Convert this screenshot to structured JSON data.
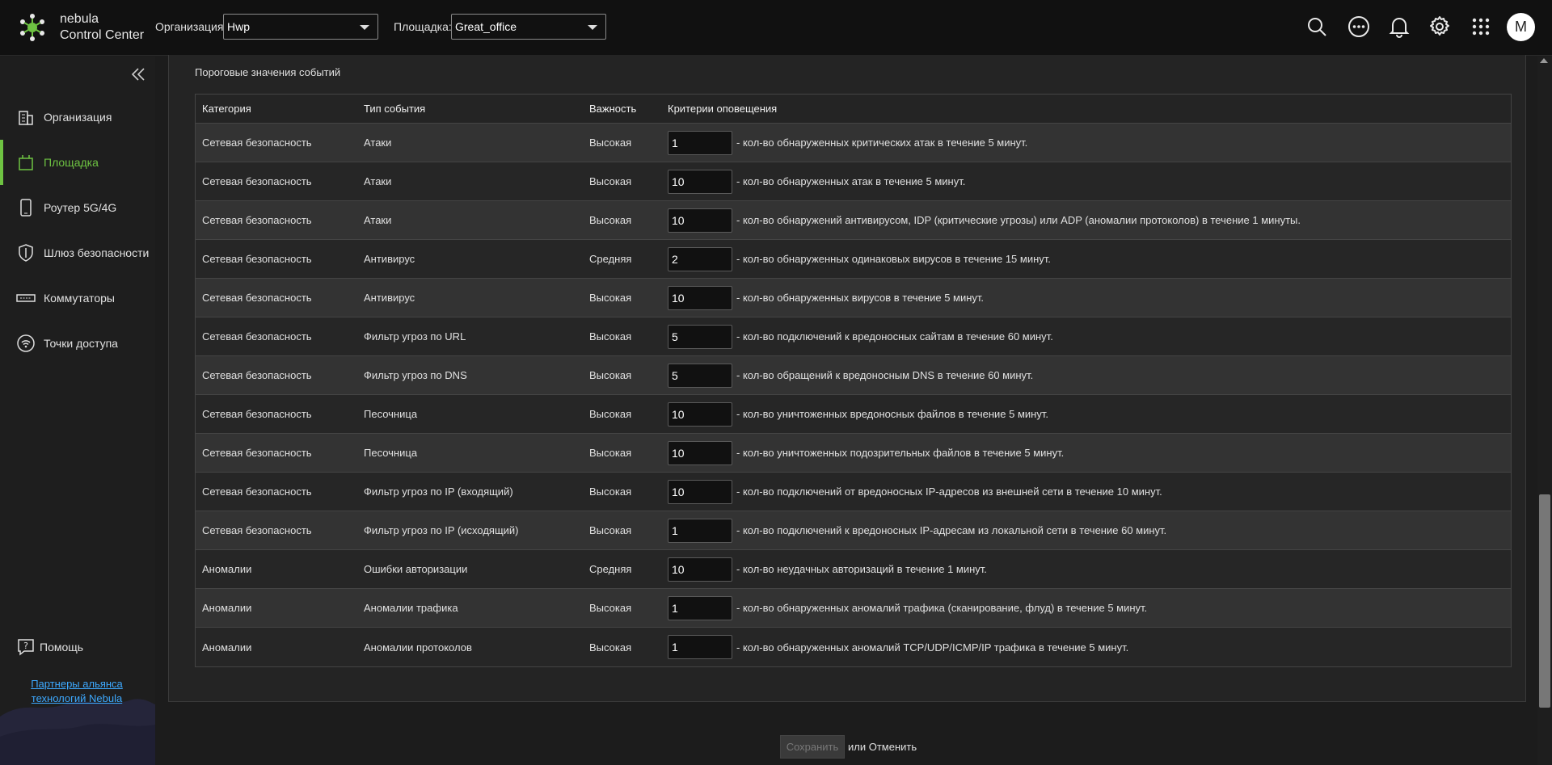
{
  "header": {
    "brand_line1": "nebula",
    "brand_line2": "Control Center",
    "org_label": "Организация:",
    "org_value": "Hwp",
    "site_label": "Площадка:",
    "site_value": "Great_office",
    "avatar_letter": "M",
    "icons": [
      "search-icon",
      "more-icon",
      "bell-icon",
      "gear-icon",
      "apps-grid-icon"
    ]
  },
  "sidebar": {
    "items": [
      {
        "label": "Организация",
        "icon": "building-icon"
      },
      {
        "label": "Площадка",
        "icon": "site-icon",
        "active": true
      },
      {
        "label": "Роутер 5G/4G",
        "icon": "mobile-router-icon"
      },
      {
        "label": "Шлюз безопасности",
        "icon": "shield-icon"
      },
      {
        "label": "Коммутаторы",
        "icon": "switch-icon"
      },
      {
        "label": "Точки доступа",
        "icon": "access-point-icon"
      }
    ],
    "help_label": "Помощь",
    "partners_line1": "Партнеры альянса",
    "partners_line2": "технологий Nebula"
  },
  "section": {
    "title": "Пороговые значения событий",
    "columns": [
      "Категория",
      "Тип события",
      "Важность",
      "Критерии оповещения"
    ],
    "rows": [
      {
        "category": "Сетевая безопасность",
        "type": "Атаки",
        "severity": "Высокая",
        "value": "1",
        "criteria": "- кол-во обнаруженных критических атак в течение 5 минут."
      },
      {
        "category": "Сетевая безопасность",
        "type": "Атаки",
        "severity": "Высокая",
        "value": "10",
        "criteria": "- кол-во обнаруженных атак в течение 5 минут."
      },
      {
        "category": "Сетевая безопасность",
        "type": "Атаки",
        "severity": "Высокая",
        "value": "10",
        "criteria": "- кол-во обнаружений антивирусом, IDP (критические угрозы) или ADP (аномалии протоколов) в течение 1 минуты."
      },
      {
        "category": "Сетевая безопасность",
        "type": "Антивирус",
        "severity": "Средняя",
        "value": "2",
        "criteria": "- кол-во обнаруженных одинаковых вирусов в течение 15 минут."
      },
      {
        "category": "Сетевая безопасность",
        "type": "Антивирус",
        "severity": "Высокая",
        "value": "10",
        "criteria": "- кол-во обнаруженных вирусов в течение 5 минут."
      },
      {
        "category": "Сетевая безопасность",
        "type": "Фильтр угроз по URL",
        "severity": "Высокая",
        "value": "5",
        "criteria": "- кол-во подключений к вредоносных сайтам в течение 60 минут."
      },
      {
        "category": "Сетевая безопасность",
        "type": "Фильтр угроз по DNS",
        "severity": "Высокая",
        "value": "5",
        "criteria": "- кол-во обращений к вредоносным DNS в течение 60 минут."
      },
      {
        "category": "Сетевая безопасность",
        "type": "Песочница",
        "severity": "Высокая",
        "value": "10",
        "criteria": "- кол-во уничтоженных вредоносных файлов в течение 5 минут."
      },
      {
        "category": "Сетевая безопасность",
        "type": "Песочница",
        "severity": "Высокая",
        "value": "10",
        "criteria": "- кол-во уничтоженных подозрительных файлов в течение 5 минут."
      },
      {
        "category": "Сетевая безопасность",
        "type": "Фильтр угроз по IP (входящий)",
        "severity": "Высокая",
        "value": "10",
        "criteria": "- кол-во подключений от вредоносных IP-адресов из внешней сети в течение 10 минут."
      },
      {
        "category": "Сетевая безопасность",
        "type": "Фильтр угроз по IP (исходящий)",
        "severity": "Высокая",
        "value": "1",
        "criteria": "- кол-во подключений к вредоносных IP-адресам из локальной сети в течение 60 минут."
      },
      {
        "category": "Аномалии",
        "type": "Ошибки авторизации",
        "severity": "Средняя",
        "value": "10",
        "criteria": "- кол-во неудачных авторизаций в течение 1 минут."
      },
      {
        "category": "Аномалии",
        "type": "Аномалии трафика",
        "severity": "Высокая",
        "value": "1",
        "criteria": "- кол-во обнаруженных аномалий трафика (сканирование, флуд) в течение 5 минут."
      },
      {
        "category": "Аномалии",
        "type": "Аномалии протоколов",
        "severity": "Высокая",
        "value": "1",
        "criteria": "- кол-во обнаруженных аномалий TCP/UDP/ICMP/IP трафика в течение 5 минут."
      }
    ]
  },
  "footer": {
    "save_label": "Сохранить",
    "or_cancel": "или Отменить"
  },
  "colors": {
    "accent": "#6ec342",
    "link": "#3da9ff"
  }
}
